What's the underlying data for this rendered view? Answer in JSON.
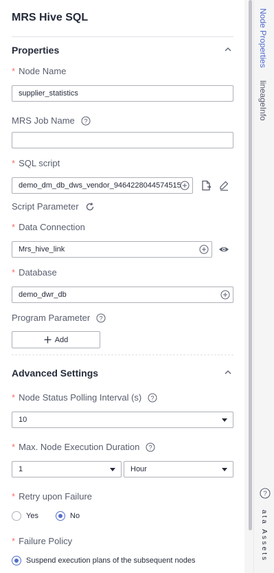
{
  "title": "MRS Hive SQL",
  "properties": {
    "section_title": "Properties",
    "node_name": {
      "label": "Node Name",
      "value": "supplier_statistics"
    },
    "mrs_job_name": {
      "label": "MRS Job Name",
      "value": ""
    },
    "sql_script": {
      "label": "SQL script",
      "value": "demo_dm_db_dws_vendor_9464228044574515"
    },
    "script_parameter": {
      "label": "Script Parameter"
    },
    "data_connection": {
      "label": "Data Connection",
      "value": "Mrs_hive_link"
    },
    "database": {
      "label": "Database",
      "value": "demo_dwr_db"
    },
    "program_parameter": {
      "label": "Program Parameter",
      "add_label": "Add"
    }
  },
  "advanced": {
    "section_title": "Advanced Settings",
    "polling_interval": {
      "label": "Node Status Polling Interval (s)",
      "value": "10"
    },
    "max_duration": {
      "label": "Max. Node Execution Duration",
      "value": "1",
      "unit": "Hour"
    },
    "retry": {
      "label": "Retry upon Failure",
      "options": [
        "Yes",
        "No"
      ],
      "selected": "No"
    },
    "failure_policy": {
      "label": "Failure Policy",
      "selected_option": "Suspend execution plans of the subsequent nodes"
    }
  },
  "side_tabs": {
    "node_properties": "Node Properties",
    "lineage_info": "lineageInfo",
    "assets": "ata Assets"
  },
  "colors": {
    "accent": "#526ecc",
    "required": "#f66f6a",
    "border": "#adb0b8"
  }
}
